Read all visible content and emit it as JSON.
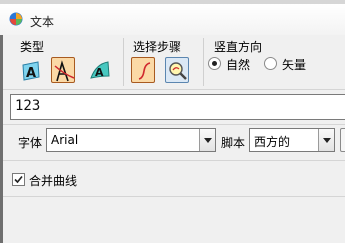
{
  "window": {
    "title": "文本",
    "app_icon": "multicolor-app-icon"
  },
  "type_group": {
    "label": "类型",
    "tools": [
      {
        "name": "text-on-plane-icon",
        "active": false
      },
      {
        "name": "text-on-curve-icon",
        "active": true
      },
      {
        "name": "text-on-face-icon",
        "active": false
      }
    ]
  },
  "select_step_group": {
    "label": "选择步骤",
    "tools": [
      {
        "name": "curve-select-icon",
        "active": true
      },
      {
        "name": "magnifier-select-icon",
        "active": false
      }
    ]
  },
  "orientation_group": {
    "label": "竖直方向",
    "options": [
      {
        "label": "自然",
        "selected": true
      },
      {
        "label": "矢量",
        "selected": false
      }
    ]
  },
  "text_value": "123",
  "font": {
    "label": "字体",
    "value": "Arial"
  },
  "script": {
    "label": "脚本",
    "value": "西方的"
  },
  "merge_curves": {
    "label": "合并曲线",
    "checked": true
  },
  "colors": {
    "active_tool_bg": "#fbd9a6",
    "active_tool_border": "#a85a20",
    "panel_bg": "#f0f0f0"
  }
}
